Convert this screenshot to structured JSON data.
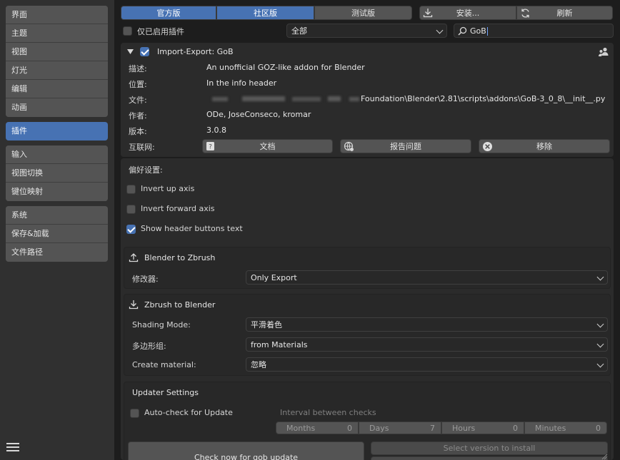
{
  "sidebar": {
    "group1": [
      "界面",
      "主题",
      "视图",
      "灯光",
      "编辑",
      "动画"
    ],
    "active": "插件",
    "group2": [
      "输入",
      "视图切换",
      "键位映射"
    ],
    "group3": [
      "系统",
      "保存&加载",
      "文件路径"
    ]
  },
  "tabs": [
    "官方版",
    "社区版",
    "测试版"
  ],
  "toolbar": {
    "install": "安装...",
    "refresh": "刷新"
  },
  "filter": {
    "enabled_only": "仅已启用插件",
    "category": "全部",
    "search": "GoB"
  },
  "addon": {
    "title": "Import-Export: GoB",
    "rows": [
      {
        "label": "描述:",
        "value": "An unofficial GOZ-like addon for Blender"
      },
      {
        "label": "位置:",
        "value": "In the info header"
      },
      {
        "label": "文件:",
        "value": "Foundation\\Blender\\2.81\\scripts\\addons\\GoB-3_0_8\\__init__.py"
      },
      {
        "label": "作者:",
        "value": "ODe, JoseConseco, kromar"
      },
      {
        "label": "版本:",
        "value": "3.0.8"
      }
    ],
    "internet_label": "互联网:",
    "buttons": {
      "docs": "文档",
      "report": "报告问题",
      "remove": "移除"
    }
  },
  "prefs": {
    "header": "偏好设置:",
    "invert_up": "Invert up axis",
    "invert_forward": "Invert forward axis",
    "show_header_text": "Show header buttons text",
    "b2z": {
      "title": "Blender to Zbrush",
      "modifier_label": "修改器:",
      "modifier_value": "Only Export"
    },
    "z2b": {
      "title": "Zbrush to Blender",
      "shading_label": "Shading Mode:",
      "shading_value": "平滑着色",
      "polygroup_label": "多边形组:",
      "polygroup_value": "from Materials",
      "material_label": "Create material:",
      "material_value": "忽略"
    },
    "updater": {
      "title": "Updater Settings",
      "autocheck": "Auto-check for Update",
      "interval": "Interval between checks",
      "months_k": "Months",
      "months_v": "0",
      "days_k": "Days",
      "days_v": "7",
      "hours_k": "Hours",
      "hours_v": "0",
      "minutes_k": "Minutes",
      "minutes_v": "0",
      "check_now": "Check now for gob update",
      "select_version": "Select version to install"
    }
  },
  "colors": {
    "accent": "#4772b3",
    "panel": "#2b2b2b",
    "sidebar": "#303030"
  }
}
